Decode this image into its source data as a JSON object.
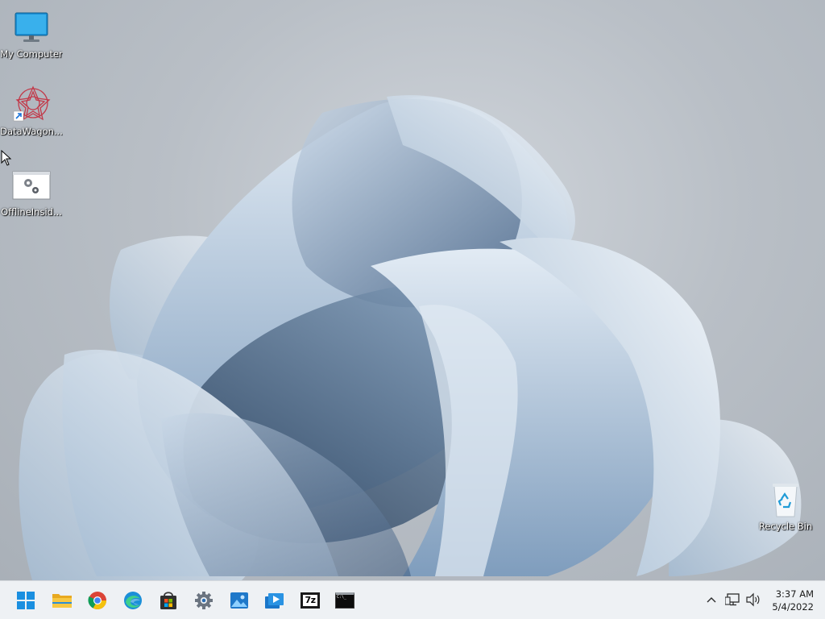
{
  "desktop": {
    "icons": [
      {
        "label": "My Computer",
        "icon": "monitor-icon"
      },
      {
        "label": "DataWagon...",
        "icon": "datawagon-shortcut-icon"
      },
      {
        "label": "OfflineInsid...",
        "icon": "settings-window-icon"
      },
      {
        "label": "Recycle Bin",
        "icon": "recycle-bin-icon"
      }
    ]
  },
  "taskbar": {
    "apps": [
      {
        "name": "Start",
        "icon": "windows-start-icon"
      },
      {
        "name": "File Explorer",
        "icon": "folder-icon"
      },
      {
        "name": "Google Chrome",
        "icon": "chrome-icon"
      },
      {
        "name": "Microsoft Edge",
        "icon": "edge-icon"
      },
      {
        "name": "Microsoft Store",
        "icon": "store-bag-icon"
      },
      {
        "name": "Settings",
        "icon": "gear-icon"
      },
      {
        "name": "Photos",
        "icon": "photos-icon"
      },
      {
        "name": "Media Player",
        "icon": "media-player-icon"
      },
      {
        "name": "7-Zip",
        "icon": "7zip-icon",
        "text": "7z"
      },
      {
        "name": "Command Prompt",
        "icon": "terminal-icon",
        "text": "C:\\_"
      }
    ],
    "tray": {
      "icons": [
        "chevron-up-icon",
        "network-icon",
        "volume-icon"
      ],
      "time": "3:37 AM",
      "date": "5/4/2022"
    }
  },
  "colors": {
    "taskbar_bg": "#eef1f4",
    "desktop_bg": "#b9bfc6",
    "bloom": "#7e9cba"
  }
}
